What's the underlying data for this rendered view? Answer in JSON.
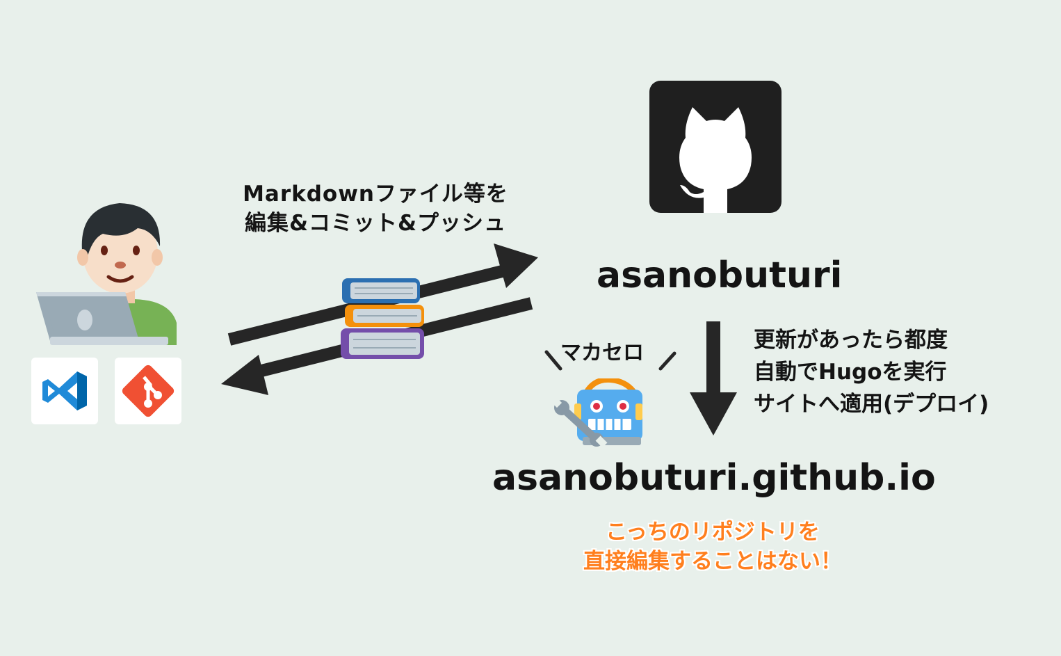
{
  "diagram": {
    "push_caption": {
      "line1": "Markdownファイル等を",
      "line2": "編集&コミット&プッシュ"
    },
    "repo_name": "asanobuturi",
    "site_name": "asanobuturi.github.io",
    "deploy_caption": {
      "line1": "更新があったら都度",
      "line2": "自動でHugoを実行",
      "line3": "サイトへ適用(デプロイ)"
    },
    "bot_caption": "マカセロ",
    "note": {
      "line1": "こっちのリポジトリを",
      "line2": "直接編集することはない！"
    },
    "icons": [
      "developer-icon",
      "vscode-icon",
      "git-icon",
      "github-icon",
      "books-icon",
      "robot-icon",
      "wrench-icon"
    ],
    "colors": {
      "background": "#e8f0eb",
      "text": "#141414",
      "note": "#ff7f1e",
      "github_tile": "#1f1f1f",
      "vscode_blue": "#1f8ad8",
      "git_red": "#f05033"
    }
  }
}
